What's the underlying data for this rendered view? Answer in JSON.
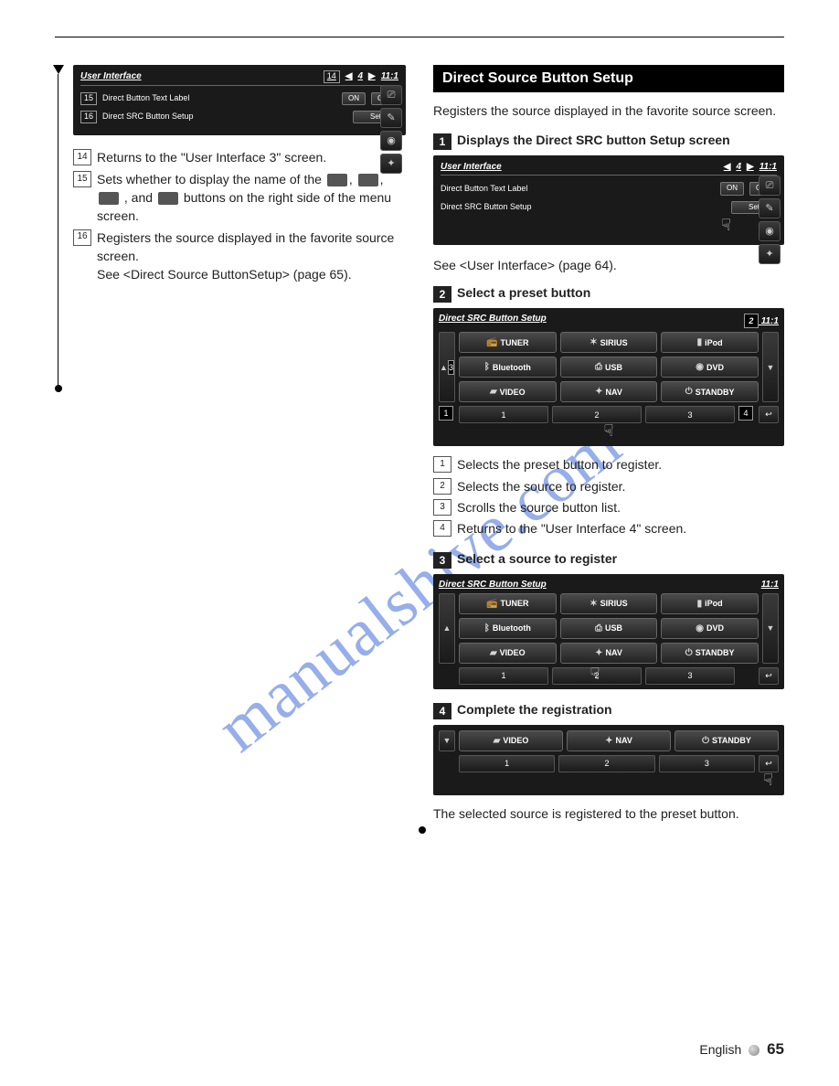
{
  "watermark": "manualshive.com",
  "left": {
    "ui": {
      "title": "User Interface",
      "title_badge": "14",
      "page": "4",
      "time": "11:1",
      "row1": {
        "badge": "15",
        "label": "Direct Button Text Label",
        "btn_on": "ON",
        "btn_off": "OFF"
      },
      "row2": {
        "badge": "16",
        "label": "Direct SRC Button Setup",
        "btn": "Set"
      }
    },
    "items": [
      {
        "n": "14",
        "text": "Returns to the \"User Interface 3\" screen."
      },
      {
        "n": "15",
        "text_a": "Sets whether to display the name of the",
        "text_b": ", and",
        "text_c": "buttons on the right side of the menu screen."
      },
      {
        "n": "16",
        "text_a": "Registers the source displayed in the favorite source screen.",
        "text_b": "See <Direct Source ButtonSetup> (page 65)."
      }
    ]
  },
  "right": {
    "heading": "Direct Source Button Setup",
    "intro": "Registers the source displayed in the favorite source screen.",
    "step1": {
      "n": "1",
      "title": "Displays the Direct SRC button Setup screen",
      "ui": {
        "title": "User Interface",
        "page": "4",
        "time": "11:1",
        "row1": {
          "label": "Direct Button Text Label",
          "btn_on": "ON",
          "btn_off": "OFF"
        },
        "row2": {
          "label": "Direct SRC Button Setup",
          "btn": "Set"
        }
      },
      "note": "See <User Interface> (page 64)."
    },
    "step2": {
      "n": "2",
      "title": "Select a preset button",
      "grid_title": "Direct SRC Button Setup",
      "time": "11:1",
      "callouts": {
        "top": "2",
        "left": "3",
        "preset": "1",
        "return": "4"
      },
      "sources": [
        "TUNER",
        "SIRIUS",
        "iPod",
        "Bluetooth",
        "USB",
        "DVD",
        "VIDEO",
        "NAV",
        "STANDBY"
      ],
      "presets": [
        "1",
        "2",
        "3"
      ],
      "notes": [
        {
          "n": "1",
          "text": "Selects the preset button to register."
        },
        {
          "n": "2",
          "text": "Selects the source to register."
        },
        {
          "n": "3",
          "text": "Scrolls the source button list."
        },
        {
          "n": "4",
          "text": "Returns to the \"User Interface 4\" screen."
        }
      ]
    },
    "step3": {
      "n": "3",
      "title": "Select a source to register",
      "grid_title": "Direct SRC Button Setup",
      "time": "11:1",
      "sources": [
        "TUNER",
        "SIRIUS",
        "iPod",
        "Bluetooth",
        "USB",
        "DVD",
        "VIDEO",
        "NAV",
        "STANDBY"
      ],
      "presets": [
        "1",
        "2",
        "3"
      ]
    },
    "step4": {
      "n": "4",
      "title": "Complete the registration",
      "row_sources": [
        "VIDEO",
        "NAV",
        "STANDBY"
      ],
      "presets": [
        "1",
        "2",
        "3"
      ],
      "note": "The selected source is registered to the preset button."
    }
  },
  "footer": {
    "lang": "English",
    "page": "65"
  }
}
